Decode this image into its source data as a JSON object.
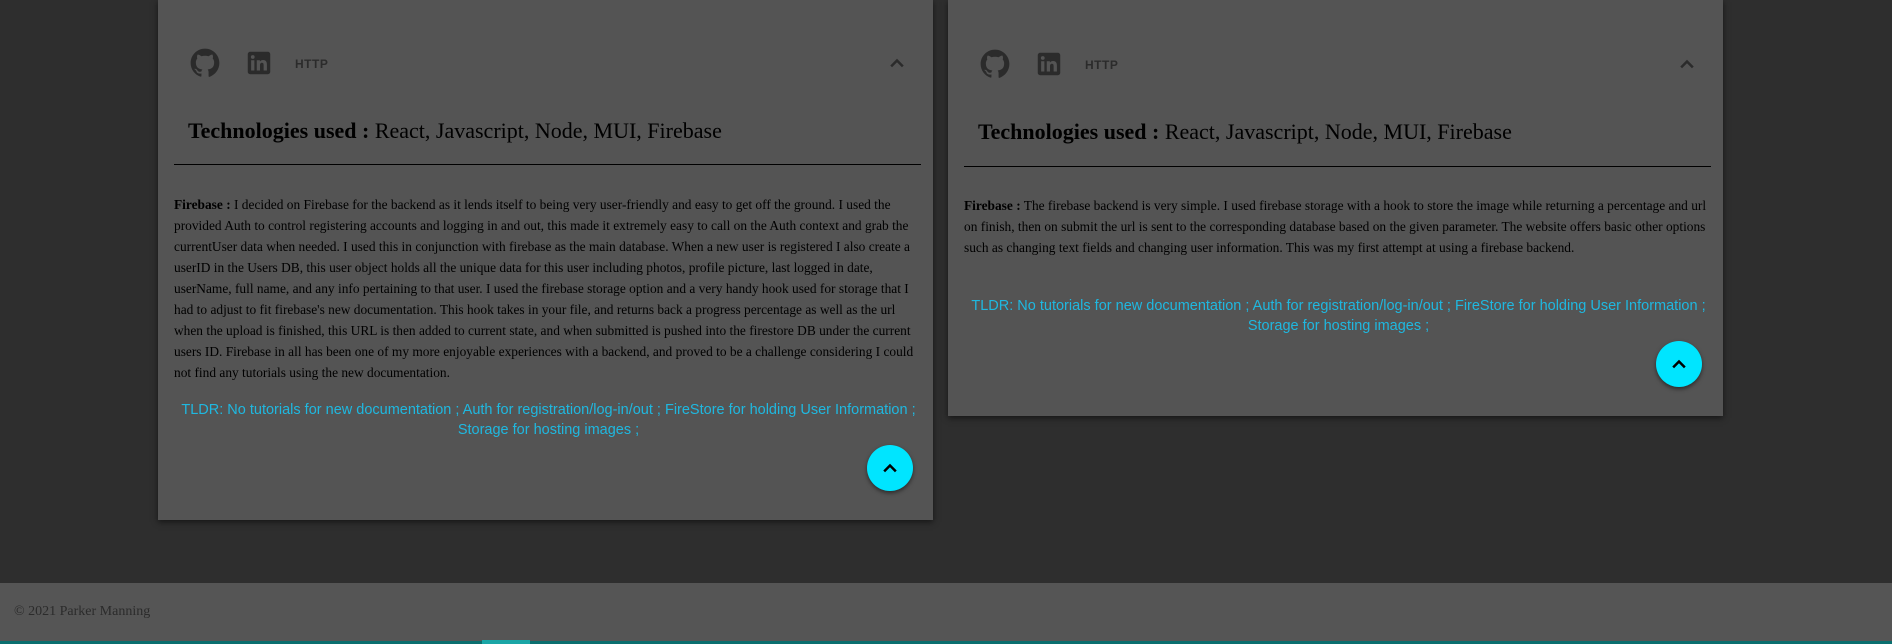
{
  "projects": [
    {
      "links": {
        "http_label": "HTTP"
      },
      "tech_label": "Technologies used :",
      "tech_list": " React, Javascript, Node, MUI, Firebase",
      "desc_label": "Firebase :",
      "desc_text": " I decided on Firebase for the backend as it lends itself to being very user-friendly and easy to get off the ground. I used the provided Auth to control registering accounts and logging in and out, this made it extremely easy to call on the Auth context and grab the currentUser data when needed. I used this in conjunction with firebase as the main database. When a new user is registered I also create a userID in the Users DB, this user object holds all the unique data for this user including photos, profile picture, last logged in date, userName, full name, and any info pertaining to that user. I used the firebase storage option and a very handy hook used for storage that I had to adjust to fit firebase's new documentation. This hook takes in your file, and returns back a progress percentage as well as the url when the upload is finished, this URL is then added to current state, and when submitted is pushed into the firestore DB under the current users ID. Firebase in all has been one of my more enjoyable experiences with a backend, and proved to be a challenge considering I could not find any tutorials using the new documentation.",
      "tldr": "TLDR: No tutorials for new documentation ; Auth for registration/log-in/out ; FireStore for holding User Information ; Storage for hosting images ;"
    },
    {
      "links": {
        "http_label": "HTTP"
      },
      "tech_label": "Technologies used :",
      "tech_list": " React, Javascript, Node, MUI, Firebase",
      "desc_label": "Firebase :",
      "desc_text": " The firebase backend is very simple. I used firebase storage with a hook to store the image while returning a percentage and url on finish, then on submit the url is sent to the corresponding database based on the given parameter. The website offers basic other options such as changing text fields and changing user information. This was my first attempt at using a firebase backend.",
      "tldr": "TLDR: No tutorials for new documentation ; Auth for registration/log-in/out ; FireStore for holding User Information ; Storage for hosting images ;"
    }
  ],
  "icons": {
    "github": "github-icon",
    "linkedin": "linkedin-icon",
    "collapse": "chevron-up-icon",
    "scroll_top": "chevron-up-icon"
  },
  "colors": {
    "background": "#2e2e2e",
    "card": "#545454",
    "accent": "#00e5ff",
    "link": "#1fb8e0"
  },
  "footer": {
    "copyright": "© 2021 Parker Manning"
  }
}
